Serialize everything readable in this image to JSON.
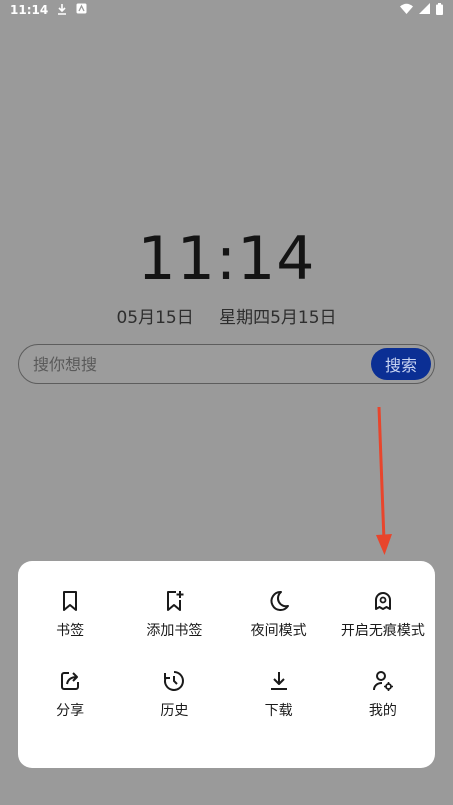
{
  "status_bar": {
    "time": "11:14"
  },
  "clock": {
    "time": "11:14",
    "date": "05月15日",
    "weekday_date": "星期四5月15日"
  },
  "search": {
    "placeholder": "搜你想搜",
    "button_label": "搜索"
  },
  "menu": {
    "items": [
      {
        "label": "书签",
        "icon": "bookmark-icon"
      },
      {
        "label": "添加书签",
        "icon": "add-bookmark-icon"
      },
      {
        "label": "夜间模式",
        "icon": "moon-icon"
      },
      {
        "label": "开启无痕模式",
        "icon": "ghost-icon"
      },
      {
        "label": "分享",
        "icon": "share-icon"
      },
      {
        "label": "历史",
        "icon": "history-clock-icon"
      },
      {
        "label": "下载",
        "icon": "download-icon"
      },
      {
        "label": "我的",
        "icon": "user-settings-icon"
      }
    ]
  },
  "colors": {
    "overlay_background": "#9a9a9a",
    "search_button": "#0b2f94",
    "annotation_arrow": "#e8452c",
    "menu_background": "#ffffff"
  }
}
